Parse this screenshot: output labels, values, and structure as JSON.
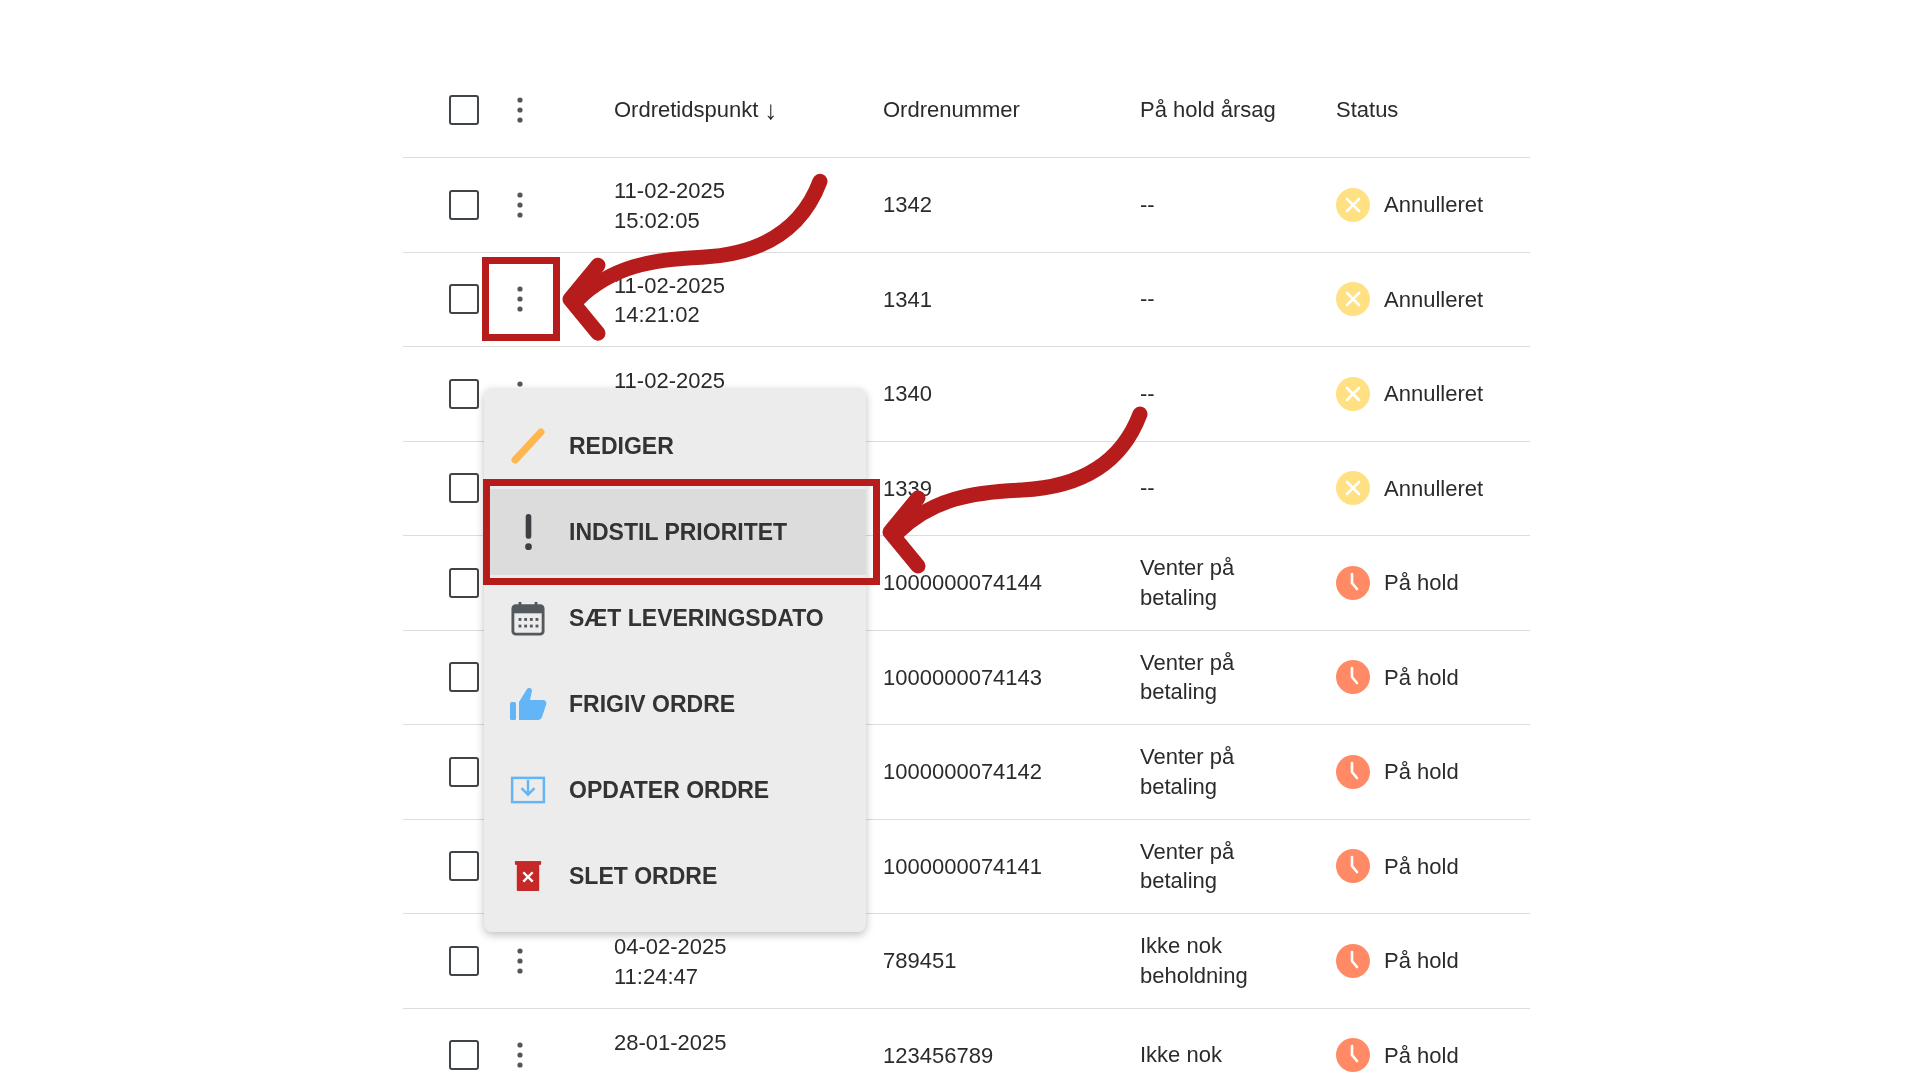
{
  "table": {
    "header": {
      "checked": false,
      "columns": [
        {
          "label": "Ordretidspunkt",
          "sort_icon": "↓"
        },
        {
          "label": "Ordrenummer"
        },
        {
          "label": "På hold årsag"
        },
        {
          "label": "Status"
        }
      ]
    },
    "rows": [
      {
        "checked": false,
        "actions": true,
        "annotated": false,
        "time": "11-02-2025 15:02:05",
        "order": "1342",
        "reason": "--",
        "status": {
          "kind": "cancelled",
          "label": "Annulleret"
        }
      },
      {
        "checked": false,
        "actions": true,
        "annotated": true,
        "time": "11-02-2025 14:21:02",
        "order": "1341",
        "reason": "--",
        "status": {
          "kind": "cancelled",
          "label": "Annulleret"
        }
      },
      {
        "checked": false,
        "actions": true,
        "annotated": false,
        "time": "11-02-2025",
        "order": "1340",
        "reason": "--",
        "status": {
          "kind": "cancelled",
          "label": "Annulleret"
        }
      },
      {
        "checked": false,
        "actions": false,
        "order": "1339",
        "reason": "--",
        "status": {
          "kind": "cancelled",
          "label": "Annulleret"
        }
      },
      {
        "checked": false,
        "actions": false,
        "order": "1000000074144",
        "reason": "Venter på betaling",
        "status": {
          "kind": "on_hold",
          "label": "På hold"
        }
      },
      {
        "checked": false,
        "actions": false,
        "order": "1000000074143",
        "reason": "Venter på betaling",
        "status": {
          "kind": "on_hold",
          "label": "På hold"
        }
      },
      {
        "checked": false,
        "actions": false,
        "order": "1000000074142",
        "reason": "Venter på betaling",
        "status": {
          "kind": "on_hold",
          "label": "På hold"
        }
      },
      {
        "checked": false,
        "actions": false,
        "order": "1000000074141",
        "reason": "Venter på betaling",
        "status": {
          "kind": "on_hold",
          "label": "På hold"
        }
      },
      {
        "checked": false,
        "actions": true,
        "annotated": false,
        "time": "04-02-2025 11:24:47",
        "order": "789451",
        "reason": "Ikke nok beholdning",
        "status": {
          "kind": "on_hold",
          "label": "På hold"
        }
      },
      {
        "checked": false,
        "actions": true,
        "annotated": false,
        "time": "28-01-2025",
        "order": "123456789",
        "reason": "Ikke nok",
        "status": {
          "kind": "on_hold",
          "label": "På hold"
        }
      }
    ]
  },
  "context_menu": {
    "items": [
      {
        "kind": "edit",
        "label": "REDIGER",
        "selected": false,
        "annotated": false
      },
      {
        "kind": "priority",
        "label": "INDSTIL PRIORITET",
        "selected": true,
        "annotated": true
      },
      {
        "kind": "calendar",
        "label": "SÆT LEVERINGSDATO",
        "selected": false,
        "annotated": false
      },
      {
        "kind": "release",
        "label": "FRIGIV ORDRE",
        "selected": false,
        "annotated": false
      },
      {
        "kind": "update",
        "label": "OPDATER ORDRE",
        "selected": false,
        "annotated": false
      },
      {
        "kind": "delete",
        "label": "SLET ORDRE",
        "selected": false,
        "annotated": false
      }
    ]
  }
}
